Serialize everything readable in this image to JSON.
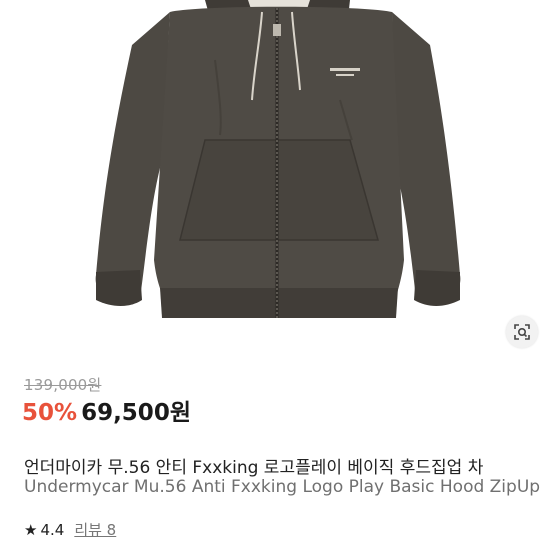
{
  "product": {
    "original_price": "139,000원",
    "discount": "50%",
    "sale_price": "69,500원",
    "title_ko": "언더마이카 무.56 안티 Fxxking 로고플레이 베이직 후드집업 차",
    "title_en": "Undermycar Mu.56 Anti Fxxking Logo Play Basic Hood ZipUp",
    "image_icon": "hooded-zip-jacket-photo",
    "garment_color": "#4b4741"
  },
  "rating": {
    "icon": "star-icon",
    "value": "4.4",
    "review_label": "리뷰 8"
  },
  "image_tools": {
    "lens_icon": "visual-search-icon"
  },
  "colors": {
    "discount": "#e8523b",
    "price": "#1a1a1a",
    "muted": "#9a9a9a"
  }
}
